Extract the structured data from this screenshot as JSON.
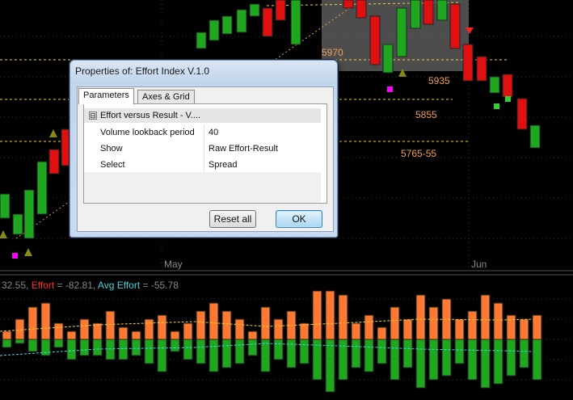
{
  "price_levels": [
    "5970",
    "5935",
    "5855",
    "5765-55"
  ],
  "date_axis": [
    "May",
    "Jun"
  ],
  "indicator_legend": {
    "first_value": "32.55,",
    "effort_label": "Effort",
    "effort_value": "= -82.81,",
    "avg_label": "Avg Effort",
    "avg_value": "= -55.78"
  },
  "dialog": {
    "title": "Properties of: Effort Index V.1.0",
    "tabs": [
      "Parameters",
      "Axes & Grid"
    ],
    "category": "Effort versus Result - V....",
    "category_toggle": "⊟",
    "properties": [
      {
        "key": "Volume lookback period",
        "value": "40"
      },
      {
        "key": "Show",
        "value": "Raw Effort-Result"
      },
      {
        "key": "Select",
        "value": "Spread"
      }
    ],
    "reset_label": "Reset all",
    "ok_label": "OK"
  },
  "colors": {
    "background": "#000000",
    "up_bar": "#1fa81f",
    "down_bar": "#e01010",
    "effort_bar": "#ff7a30",
    "level_line": "#f0d040",
    "avg_line": "#40d8e0",
    "marker_magenta": "#ff00ff",
    "marker_olive": "#8a8a10"
  }
}
